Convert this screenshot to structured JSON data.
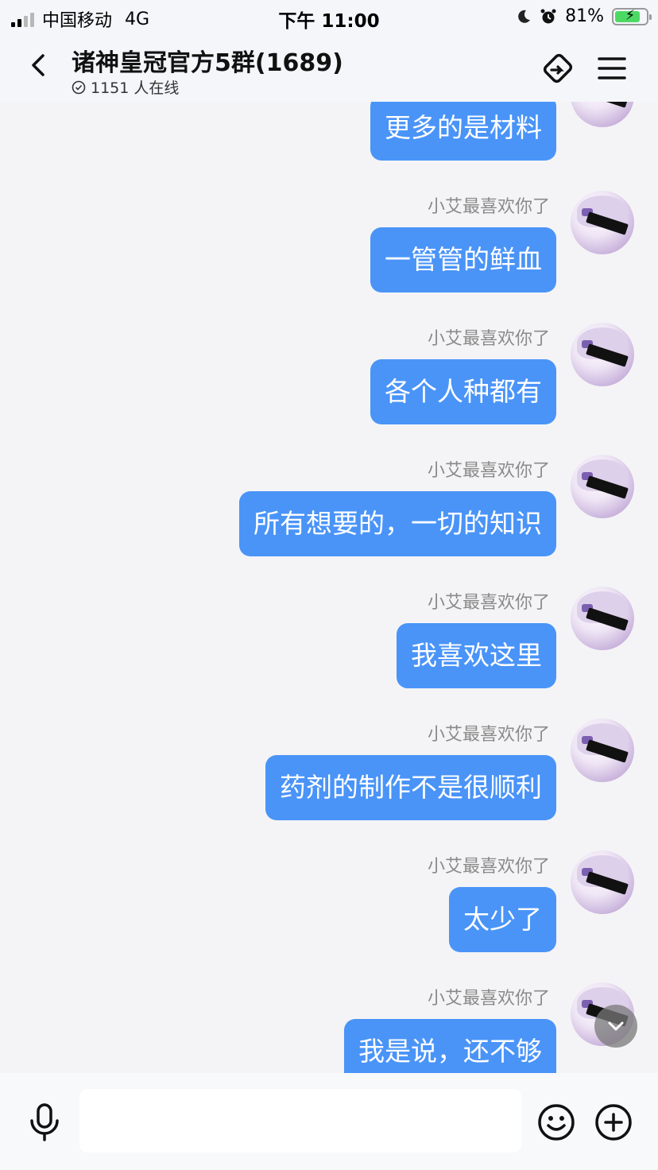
{
  "status_bar": {
    "carrier": "中国移动",
    "network": "4G",
    "time": "下午 11:00",
    "battery_percent": "81%",
    "battery_level": 0.81
  },
  "header": {
    "title": "诸神皇冠官方5群(1689)",
    "online_count": "1151 人在线"
  },
  "messages": [
    {
      "nickname": "",
      "text": "更多的是材料"
    },
    {
      "nickname": "小艾最喜欢你了",
      "text": "一管管的鲜血"
    },
    {
      "nickname": "小艾最喜欢你了",
      "text": "各个人种都有"
    },
    {
      "nickname": "小艾最喜欢你了",
      "text": "所有想要的，一切的知识"
    },
    {
      "nickname": "小艾最喜欢你了",
      "text": "我喜欢这里"
    },
    {
      "nickname": "小艾最喜欢你了",
      "text": "药剂的制作不是很顺利"
    },
    {
      "nickname": "小艾最喜欢你了",
      "text": "太少了"
    },
    {
      "nickname": "小艾最喜欢你了",
      "text": "我是说，还不够"
    }
  ],
  "input": {
    "value": "",
    "placeholder": ""
  },
  "colors": {
    "bubble": "#4a94f8",
    "nickname": "#8a8a8a",
    "background": "#f4f4f6"
  },
  "icons": [
    "back-arrow-icon",
    "clock-check-icon",
    "link-share-icon",
    "menu-icon",
    "microphone-icon",
    "emoji-icon",
    "plus-icon",
    "chevron-down-icon",
    "moon-icon",
    "alarm-icon",
    "battery-icon",
    "signal-icon"
  ]
}
